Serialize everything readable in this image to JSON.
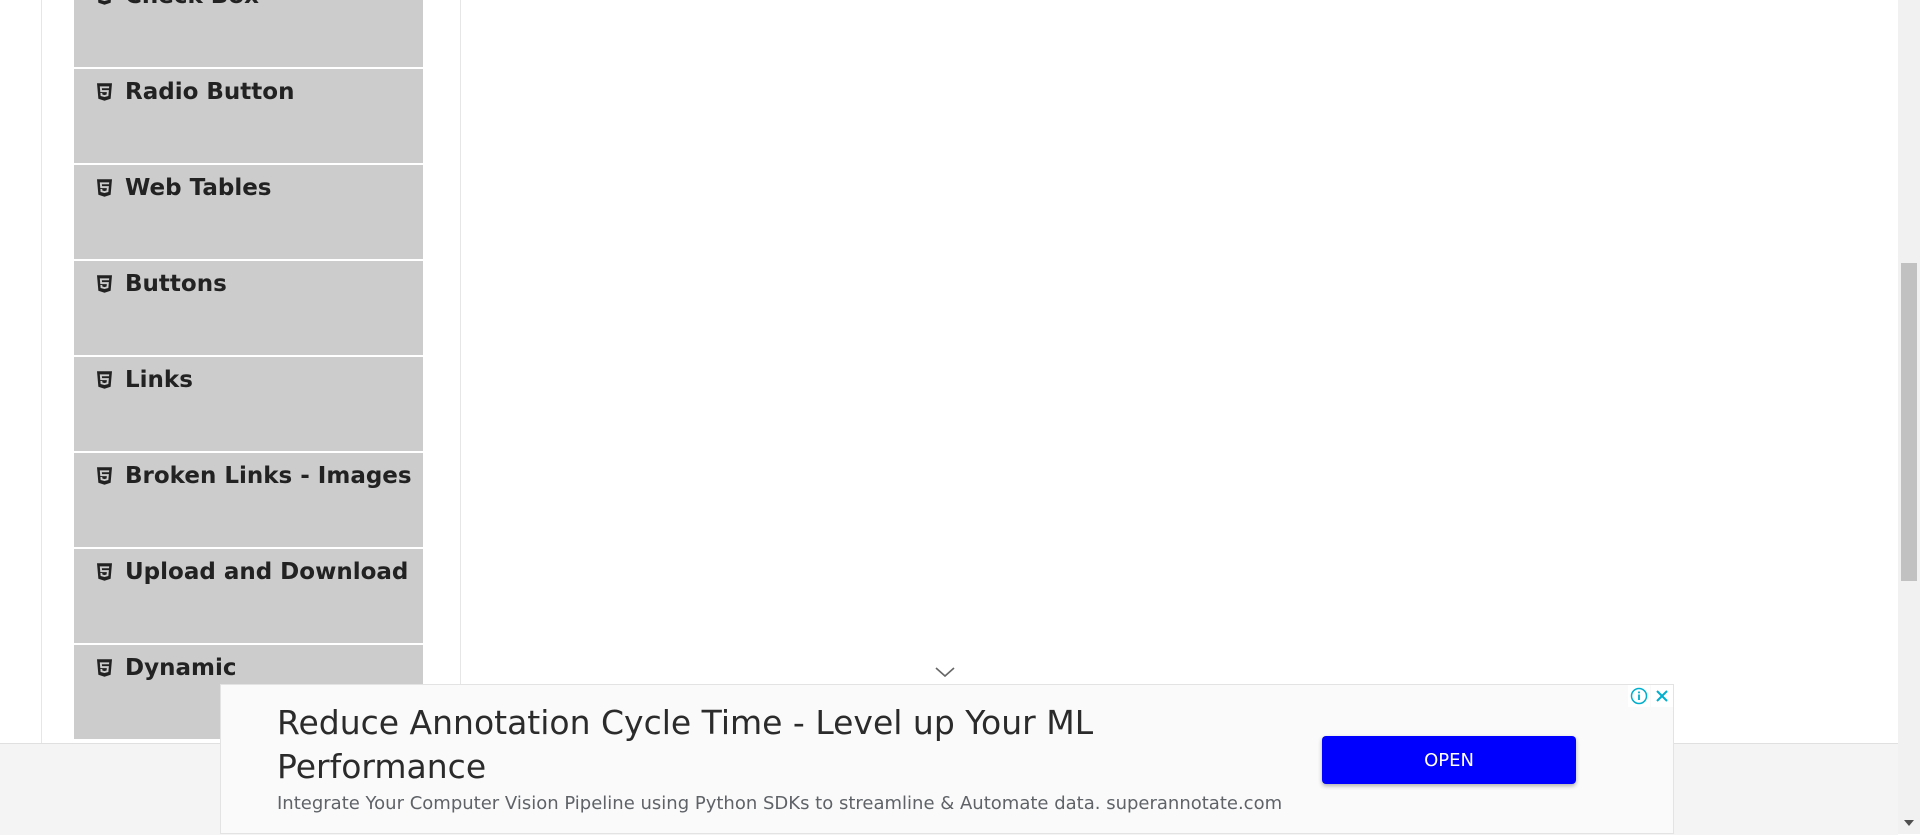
{
  "sidebar": {
    "items": [
      {
        "label": "Check Box",
        "icon": "html5-icon"
      },
      {
        "label": "Radio Button",
        "icon": "html5-icon"
      },
      {
        "label": "Web Tables",
        "icon": "html5-icon"
      },
      {
        "label": "Buttons",
        "icon": "html5-icon"
      },
      {
        "label": "Links",
        "icon": "html5-icon"
      },
      {
        "label": "Broken Links - Images",
        "icon": "html5-icon"
      },
      {
        "label": "Upload and Download",
        "icon": "html5-icon"
      },
      {
        "label": "Dynamic",
        "icon": "html5-icon"
      }
    ]
  },
  "ad": {
    "headline": "Reduce Annotation Cycle Time - Level up Your ML Performance",
    "description": "Integrate Your Computer Vision Pipeline using Python SDKs to streamline & Automate data. superannotate.com",
    "open_label": "OPEN",
    "button_color": "#0000ff",
    "info_icon": "info-icon",
    "close_icon": "close-icon",
    "collapse_icon": "chevron-down-icon"
  }
}
